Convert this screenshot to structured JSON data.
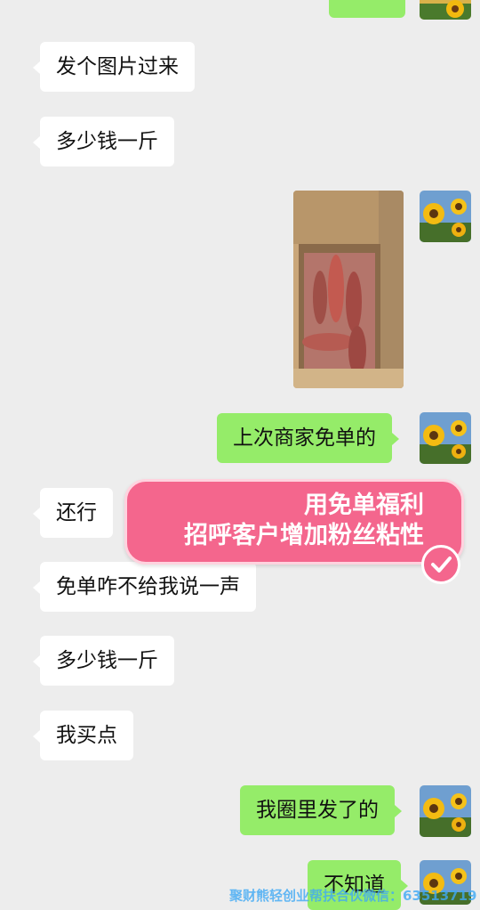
{
  "messages": {
    "top_sent_partial": "",
    "m1": "发个图片过来",
    "m2": "多少钱一斤",
    "m3": "上次商家免单的",
    "m4": "还行",
    "m5": "免单咋不给我说一声",
    "m6": "多少钱一斤",
    "m7": "我买点",
    "m8": "我圈里发了的",
    "m9": "不知道"
  },
  "banner": {
    "line1": "用免单福利",
    "line2": "招呼客户增加粉丝粘性"
  },
  "watermark": "聚财熊轻创业帮扶合伙微信：63513719",
  "colors": {
    "background": "#ededed",
    "sent_bubble": "#95ec69",
    "received_bubble": "#ffffff",
    "banner": "#f4668d",
    "watermark": "#3fa9f5"
  },
  "icons": {
    "avatar": "sunflower-avatar",
    "photo": "sweet-potatoes-in-box-photo",
    "check": "check-circle-icon"
  }
}
